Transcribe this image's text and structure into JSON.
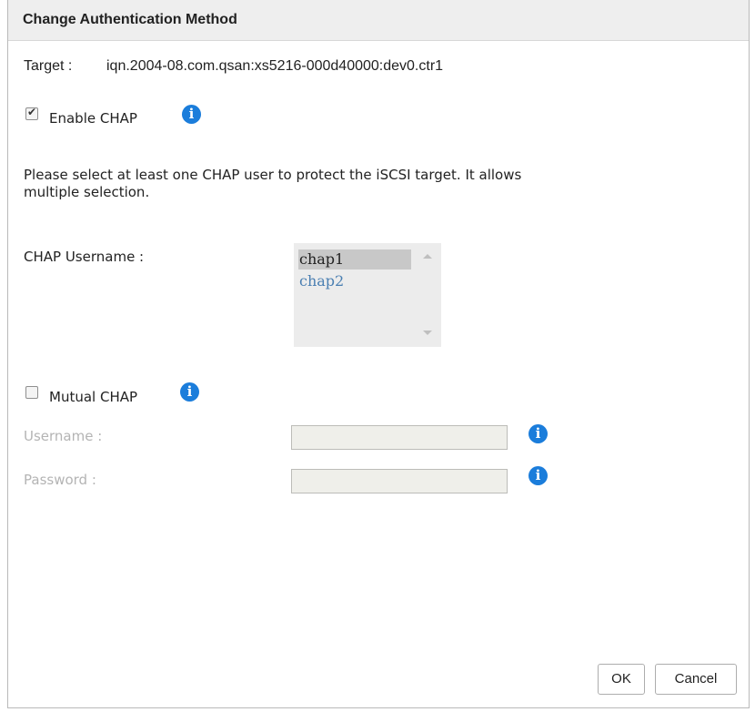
{
  "dialog": {
    "title": "Change Authentication Method"
  },
  "target": {
    "label": "Target :",
    "value": "iqn.2004-08.com.qsan:xs5216-000d40000:dev0.ctr1"
  },
  "enable_chap": {
    "label": "Enable CHAP",
    "checked": true
  },
  "description": "Please select at least one CHAP user to protect the iSCSI target. It allows multiple selection.",
  "chap_username": {
    "label": "CHAP Username :",
    "options": [
      {
        "label": "chap1",
        "selected": true
      },
      {
        "label": "chap2",
        "selected": false
      }
    ]
  },
  "mutual_chap": {
    "label": "Mutual CHAP",
    "checked": false,
    "username_label": "Username :",
    "password_label": "Password :",
    "username_value": "",
    "password_value": ""
  },
  "buttons": {
    "ok": "OK",
    "cancel": "Cancel"
  },
  "colors": {
    "info_icon": "#1b7ddb",
    "title_bar": "#eeeeee",
    "selected_option": "#c8c8c8",
    "unselected_option_text": "#4a7fb2"
  },
  "icons": {
    "info": "info-icon",
    "scroll_up": "chevron-up-icon",
    "scroll_down": "chevron-down-icon",
    "check": "checkmark-icon"
  }
}
